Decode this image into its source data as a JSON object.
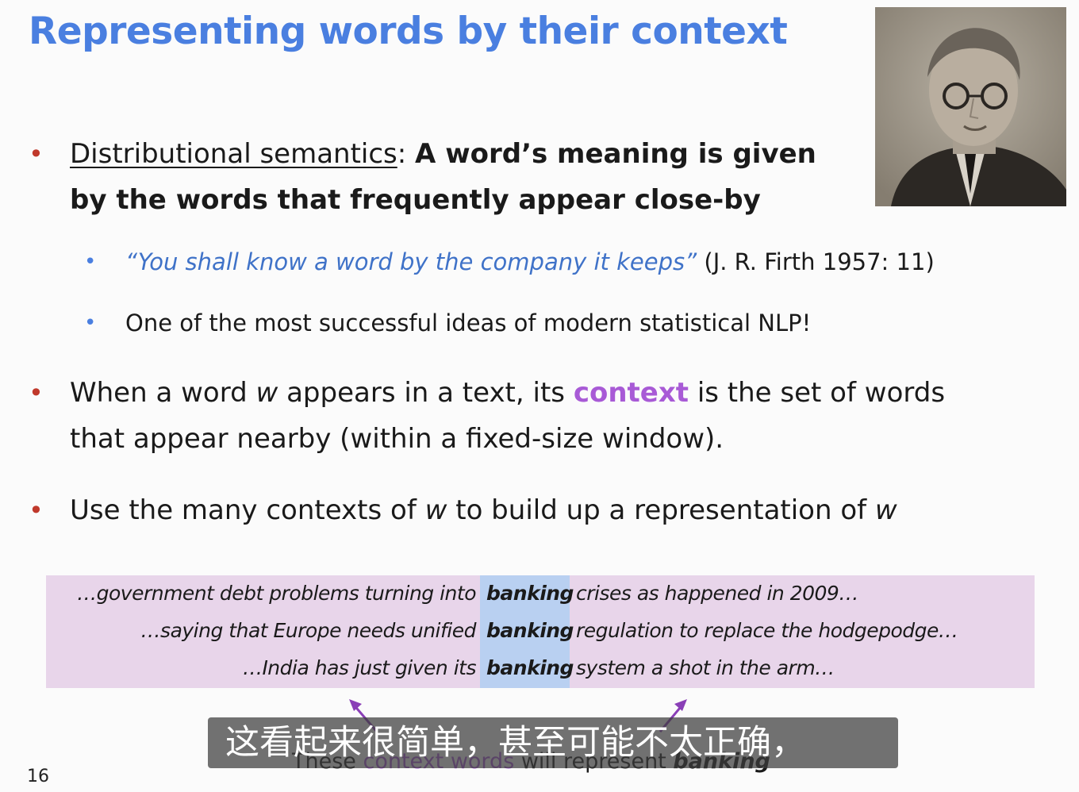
{
  "slide": {
    "title": "Representing words by their context",
    "page_number": "16"
  },
  "bullets": {
    "b1": {
      "term": "Distributional semantics",
      "colon": ":",
      "line1_bold": "A word’s meaning is given",
      "line2_bold": "by the words that frequently appear close-by"
    },
    "sub1": {
      "quote": "“You shall know a word by the company it keeps”",
      "citation": "(J. R. Firth 1957: 11)"
    },
    "sub2": {
      "text": "One of the most successful ideas of modern statistical NLP!"
    },
    "b2": {
      "p1": "When a word ",
      "w": "w",
      "p2": " appears in a text, its ",
      "context": "context",
      "p3": " is the set of words",
      "line2": "that appear nearby (within a fixed-size window)."
    },
    "b3": {
      "p1": "Use the many contexts of ",
      "w1": "w",
      "p2": " to build up a representation of ",
      "w2": "w"
    }
  },
  "kwic": {
    "rows": [
      {
        "left": "…government debt problems turning into",
        "center": "banking",
        "right": "crises as happened in 2009…"
      },
      {
        "left": "…saying that Europe needs unified",
        "center": "banking",
        "right": "regulation to replace the hodgepodge…"
      },
      {
        "left": "…India has just given its",
        "center": "banking",
        "right": "system a shot in the arm…"
      }
    ]
  },
  "caption": {
    "p1": "These ",
    "p2": "context words",
    "p3": " will represent ",
    "p4": "banking"
  },
  "video_subtitle": "这看起来很简单，甚至可能不太正确，",
  "colors": {
    "title": "#4a7fe0",
    "bullet_dot": "#c0392b",
    "context_purple": "#a85ad6",
    "quote_blue": "#3f72c8",
    "kwic_bg": "#e8d5ea",
    "kwic_center_bg": "#b9d0f1"
  }
}
